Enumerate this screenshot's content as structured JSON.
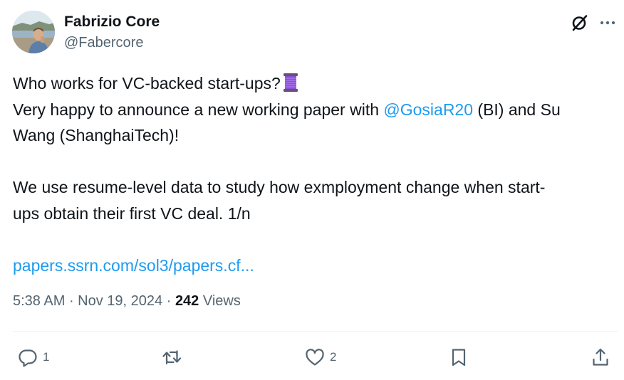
{
  "author": {
    "display_name": "Fabrizio Core",
    "handle": "@Fabercore"
  },
  "header_icons": [
    "grok-icon",
    "more-options-icon"
  ],
  "tweet": {
    "line1": "Who works for VC-backed start-ups?",
    "line1_emoji": "spool-of-thread-emoji",
    "line2_before": "Very happy to announce a new working paper with ",
    "mention": "@GosiaR20",
    "line2_after": " (BI) and Su",
    "line3": "Wang (ShanghaiTech)!",
    "line4": "We use resume-level data to study how exmployment change when start-",
    "line5": "ups obtain their first VC deal. 1/n",
    "link": "papers.ssrn.com/sol3/papers.cf..."
  },
  "meta": {
    "time": "5:38 AM",
    "sep1": " · ",
    "date": "Nov 19, 2024",
    "sep2": " · ",
    "views_count": "242",
    "views_label": " Views"
  },
  "actions": {
    "reply_count": "1",
    "like_count": "2",
    "icons": [
      "reply-icon",
      "retweet-icon",
      "like-icon",
      "bookmark-icon",
      "share-icon"
    ]
  },
  "colors": {
    "text": "#0f1419",
    "secondary": "#536471",
    "link": "#1d9bf0",
    "divider": "#eff3f4"
  }
}
